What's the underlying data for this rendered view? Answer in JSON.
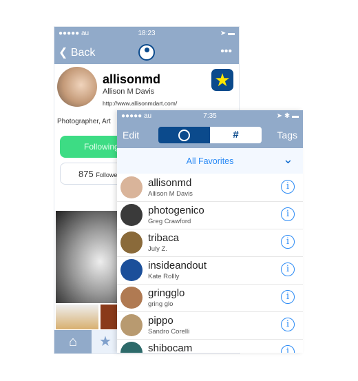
{
  "back_screen": {
    "status": {
      "carrier": "●●●●● au",
      "time": "18:23"
    },
    "nav": {
      "back_label": "Back",
      "more_label": "•••"
    },
    "profile": {
      "username": "allisonmd",
      "full_name": "Allison M Davis",
      "url": "http://www.allisonmdart.com/",
      "bio": "Photographer, Art",
      "following_label": "Following",
      "followers_count": "875",
      "followers_label": "Followe"
    },
    "tabs": [
      "home",
      "favorites"
    ]
  },
  "front_screen": {
    "status": {
      "carrier": "●●●●● au",
      "time": "7:35"
    },
    "nav": {
      "edit_label": "Edit",
      "hash_label": "#",
      "tags_label": "Tags",
      "selected_segment": "user"
    },
    "filter": {
      "label": "All Favorites"
    },
    "contacts": [
      {
        "username": "allisonmd",
        "name": "Allison M Davis",
        "color": "#d9b49a"
      },
      {
        "username": "photogenico",
        "name": "Greg Crawford",
        "color": "#3a3a3a"
      },
      {
        "username": "tribaca",
        "name": "July Z.",
        "color": "#8a6a3a"
      },
      {
        "username": "insideandout",
        "name": "Kate Rollly",
        "color": "#1b4f9a"
      },
      {
        "username": "gringglo",
        "name": "gring glo",
        "color": "#b07a52"
      },
      {
        "username": "pippo",
        "name": "Sandro Corelli",
        "color": "#b89a70"
      },
      {
        "username": "shibocam",
        "name": "",
        "color": "#2d6a6a"
      }
    ]
  },
  "colors": {
    "nav": "#91aac9",
    "accent": "#2a8af5",
    "dark_blue": "#0b4a8c",
    "green": "#3ddc84",
    "star": "#ffe600"
  }
}
